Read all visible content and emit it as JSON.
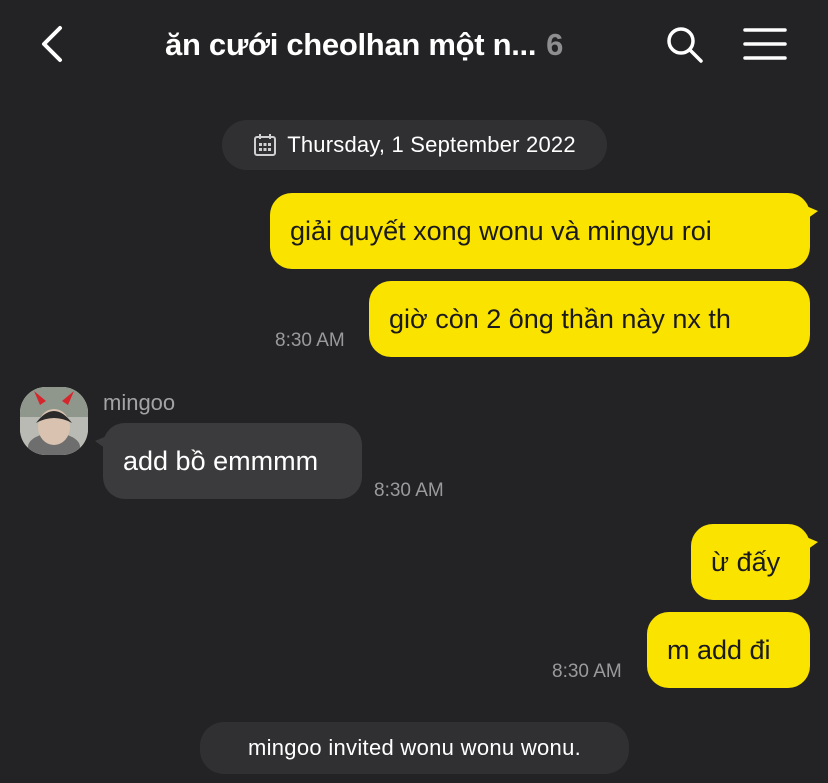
{
  "header": {
    "back_icon": "chevron-left-icon",
    "title": "ăn cưới cheolhan một n...",
    "member_count": "6",
    "search_icon": "search-icon",
    "menu_icon": "hamburger-menu-icon"
  },
  "date_divider": {
    "icon": "calendar-icon",
    "text": "Thursday, 1 September 2022"
  },
  "messages": [
    {
      "sender": "me",
      "text": "giải quyết xong wonu và mingyu roi",
      "time": ""
    },
    {
      "sender": "me",
      "text": "giờ còn 2 ông thần này nx th",
      "time": "8:30 AM"
    },
    {
      "sender": "mingoo",
      "text": "add bồ emmmm",
      "time": "8:30 AM"
    },
    {
      "sender": "me",
      "text": "ừ đấy",
      "time": ""
    },
    {
      "sender": "me",
      "text": "m add đi",
      "time": "8:30 AM"
    }
  ],
  "other_user": {
    "name": "mingoo",
    "avatar": "avatar-photo-devil-horns"
  },
  "system_message": "mingoo invited wonu wonu wonu.",
  "colors": {
    "background": "#232325",
    "my_bubble": "#fbe300",
    "their_bubble": "#3b3b3e",
    "pill": "#303033",
    "timestamp": "#9a9a9c"
  }
}
